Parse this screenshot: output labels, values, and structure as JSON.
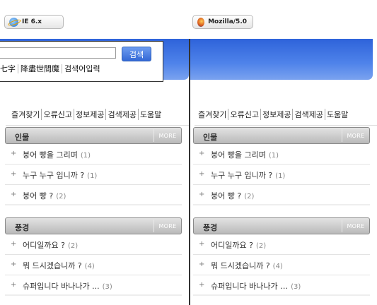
{
  "badges": {
    "ie": "IE 6.x",
    "mozilla": "Mozilla/5.0"
  },
  "search": {
    "button": "검색",
    "links": [
      "七字",
      "降盡世間魔",
      "검색어입력"
    ]
  },
  "toolbar": [
    "즐겨찾기",
    "오류신고",
    "정보제공",
    "검색제공",
    "도움말"
  ],
  "sections": [
    {
      "title": "인물",
      "more": "MORE",
      "items": [
        {
          "text": "붕어 빵을 그리며",
          "count": "(1)"
        },
        {
          "text": "누구 누구 입니까 ?",
          "count": "(1)"
        },
        {
          "text": "붕어 빵 ?",
          "count": "(2)"
        }
      ]
    },
    {
      "title": "풍경",
      "more": "MORE",
      "items": [
        {
          "text": "어디일까요 ?",
          "count": "(2)"
        },
        {
          "text": "뭐 드시겠습니까 ?",
          "count": "(4)"
        },
        {
          "text": "슈퍼입니다 바나나가 ...",
          "count": "(3)"
        }
      ]
    }
  ],
  "sections_right_last_text": "슈퍼입니다 바나나가 …"
}
